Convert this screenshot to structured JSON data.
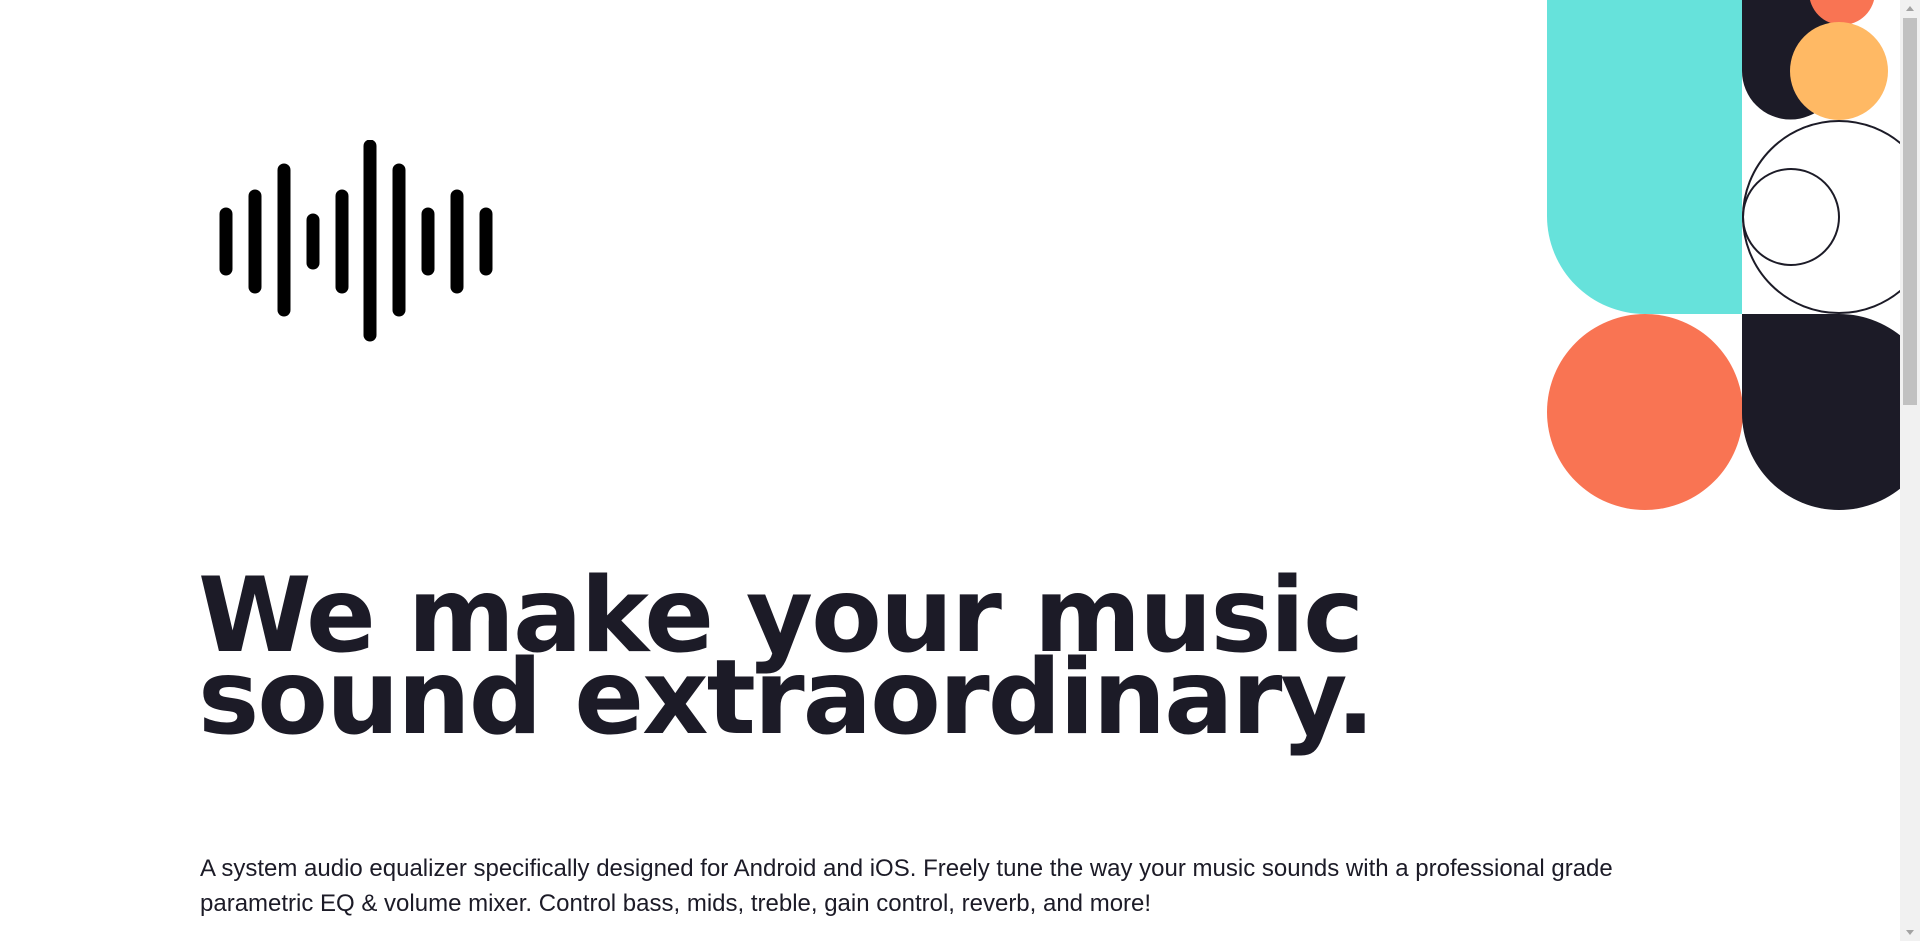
{
  "hero": {
    "headline": "We make your music sound extraordinary.",
    "description": "A system audio equalizer specifically designed for Android and iOS. Freely tune the way your music sounds with a professional grade parametric EQ & volume mixer. Control bass, mids, treble, gain control, reverb, and more!"
  },
  "logo": {
    "icon": "sound-wave-icon",
    "color": "#000000"
  },
  "pattern": {
    "colors": {
      "teal": "#66e2db",
      "coral": "#f97453",
      "navy": "#1c1b27",
      "yellow": "#ffb964",
      "outline": "#1c1b27"
    }
  }
}
